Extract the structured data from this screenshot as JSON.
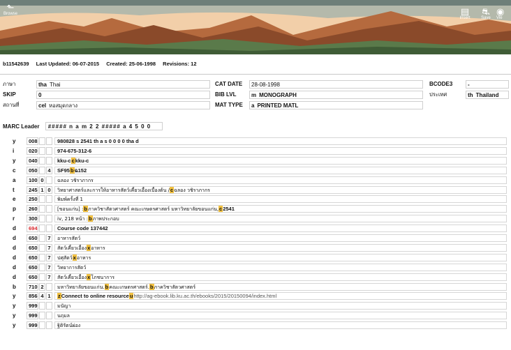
{
  "toolbar": {
    "browse_label": "Browse",
    "insert_label": "Insert",
    "save_label": "Save",
    "view_label": "Vie"
  },
  "record_info": {
    "record_id": "b11542639",
    "last_updated": "Last Updated: 06-07-2015",
    "created": "Created: 25-06-1998",
    "revisions": "Revisions: 12"
  },
  "fixed_fields": {
    "lang": {
      "label": "ภาษา",
      "code": "tha",
      "value": "Thai"
    },
    "skip": {
      "label": "SKIP",
      "code": "0",
      "value": ""
    },
    "location": {
      "label": "สถานที่",
      "code": "cel",
      "value": "หอสมุดกลาง"
    },
    "cat_date": {
      "label": "CAT DATE",
      "code": "28-08-1998",
      "value": ""
    },
    "bib_lvl": {
      "label": "BIB LVL",
      "code": "m",
      "value": "MONOGRAPH"
    },
    "mat_type": {
      "label": "MAT TYPE",
      "code": "a",
      "value": "PRINTED MATL"
    },
    "bcode3": {
      "label": "BCODE3",
      "code": "-",
      "value": ""
    },
    "country": {
      "label": "ประเทศ",
      "code": "th",
      "value": "Thailand"
    }
  },
  "marc_leader": {
    "label": "MARC Leader",
    "value": "##### n a m   2 2 ##### a  4 5 0 0"
  },
  "marc_fields": [
    {
      "type": "y",
      "tag": "008",
      "ind1": "",
      "ind2": "",
      "parts": [
        {
          "t": "980828 s 2541    th a             s 0 0 0  0  tha  d",
          "k": "n"
        }
      ]
    },
    {
      "type": "i",
      "tag": "020",
      "ind1": "",
      "ind2": "",
      "parts": [
        {
          "t": "974-675-312-6",
          "k": "n"
        }
      ]
    },
    {
      "type": "y",
      "tag": "040",
      "ind1": "",
      "ind2": "",
      "parts": [
        {
          "t": "kku-c",
          "k": "n"
        },
        {
          "t": "c",
          "k": "s"
        },
        {
          "t": "kku-c",
          "k": "n"
        }
      ]
    },
    {
      "type": "c",
      "tag": "050",
      "ind1": "",
      "ind2": "4",
      "parts": [
        {
          "t": "SF95",
          "k": "n"
        },
        {
          "t": "b",
          "k": "s"
        },
        {
          "t": "ฉ152",
          "k": "n"
        }
      ]
    },
    {
      "type": "a",
      "tag": "100",
      "ind1": "0",
      "ind2": "",
      "parts": [
        {
          "t": "ฉลอง วชิราภากร",
          "k": "p"
        }
      ]
    },
    {
      "type": "t",
      "tag": "245",
      "ind1": "1",
      "ind2": "0",
      "parts": [
        {
          "t": "วิทยาศาสตร์และการให้อาหารสัตว์เคี้ยวเอื้องเบื้องต้น /",
          "k": "p"
        },
        {
          "t": "c",
          "k": "s"
        },
        {
          "t": "ฉลอง วชิราภากร",
          "k": "p"
        }
      ]
    },
    {
      "type": "e",
      "tag": "250",
      "ind1": "",
      "ind2": "",
      "parts": [
        {
          "t": "พิมพ์ครั้งที่ 1",
          "k": "p"
        }
      ]
    },
    {
      "type": "p",
      "tag": "260",
      "ind1": "",
      "ind2": "",
      "parts": [
        {
          "t": "[ขอนแก่น] :",
          "k": "p"
        },
        {
          "t": "b",
          "k": "s"
        },
        {
          "t": "ภาควิชาสัตวศาสตร์ คณะเกษตรศาสตร์ มหาวิทยาลัยขอนแก่น,",
          "k": "p"
        },
        {
          "t": "c",
          "k": "s"
        },
        {
          "t": "2541",
          "k": "n"
        }
      ]
    },
    {
      "type": "r",
      "tag": "300",
      "ind1": "",
      "ind2": "",
      "parts": [
        {
          "t": "iv, 218 หน้า :",
          "k": "p"
        },
        {
          "t": "b",
          "k": "s"
        },
        {
          "t": "ภาพประกอบ",
          "k": "p"
        }
      ]
    },
    {
      "type": "d",
      "tag": "694",
      "ind1": "",
      "ind2": "",
      "red": true,
      "parts": [
        {
          "t": "Course code 137442",
          "k": "n"
        }
      ]
    },
    {
      "type": "d",
      "tag": "650",
      "ind1": "",
      "ind2": "7",
      "parts": [
        {
          "t": "อาหารสัตว์",
          "k": "p"
        }
      ]
    },
    {
      "type": "d",
      "tag": "650",
      "ind1": "",
      "ind2": "7",
      "parts": [
        {
          "t": "สัตว์เคี้ยวเอื้อง",
          "k": "p"
        },
        {
          "t": "x",
          "k": "s"
        },
        {
          "t": "อาหาร",
          "k": "p"
        }
      ]
    },
    {
      "type": "d",
      "tag": "650",
      "ind1": "",
      "ind2": "7",
      "parts": [
        {
          "t": "ปศุสัตว์",
          "k": "p"
        },
        {
          "t": "x",
          "k": "s"
        },
        {
          "t": "อาหาร",
          "k": "p"
        }
      ]
    },
    {
      "type": "d",
      "tag": "650",
      "ind1": "",
      "ind2": "7",
      "parts": [
        {
          "t": "วิทยาการสัตว์",
          "k": "p"
        }
      ]
    },
    {
      "type": "d",
      "tag": "650",
      "ind1": "",
      "ind2": "7",
      "parts": [
        {
          "t": "สัตว์เคี้ยวเอื้อง",
          "k": "p"
        },
        {
          "t": "x",
          "k": "s"
        },
        {
          "t": "โภชนาการ",
          "k": "p"
        }
      ]
    },
    {
      "type": "b",
      "tag": "710",
      "ind1": "2",
      "ind2": "",
      "parts": [
        {
          "t": "มหาวิทยาลัยขอนแก่น.",
          "k": "p"
        },
        {
          "t": "b",
          "k": "s"
        },
        {
          "t": "คณะเกษตรศาสตร์.",
          "k": "p"
        },
        {
          "t": "b",
          "k": "s"
        },
        {
          "t": "ภาควิชาสัตวศาสตร์",
          "k": "p"
        }
      ]
    },
    {
      "type": "y",
      "tag": "856",
      "ind1": "4",
      "ind2": "1",
      "parts": [
        {
          "t": "z",
          "k": "s"
        },
        {
          "t": "Connect to online resource",
          "k": "n"
        },
        {
          "t": "u",
          "k": "s"
        },
        {
          "t": "http://ag-ebook.lib.ku.ac.th/ebooks/2015/20150094/index.html",
          "k": "u"
        }
      ]
    },
    {
      "type": "y",
      "tag": "999",
      "ind1": "",
      "ind2": "",
      "parts": [
        {
          "t": "มนัญา",
          "k": "p"
        }
      ]
    },
    {
      "type": "y",
      "tag": "999",
      "ind1": "",
      "ind2": "",
      "parts": [
        {
          "t": "นฤมล",
          "k": "p"
        }
      ]
    },
    {
      "type": "y",
      "tag": "999",
      "ind1": "",
      "ind2": "",
      "parts": [
        {
          "t": "ฐิติรัตน์ผ่อง",
          "k": "p"
        }
      ]
    }
  ],
  "colors": {
    "subfield_highlight": "#f3c242",
    "error_tag": "#d8262c",
    "banner_sky": "#f0c9a2",
    "mountain_brown": "#8a4a2a",
    "hill_green": "#5a7a4a"
  },
  "icons": [
    "back-arrow-icon",
    "insert-icon",
    "save-icon",
    "view-icon"
  ]
}
